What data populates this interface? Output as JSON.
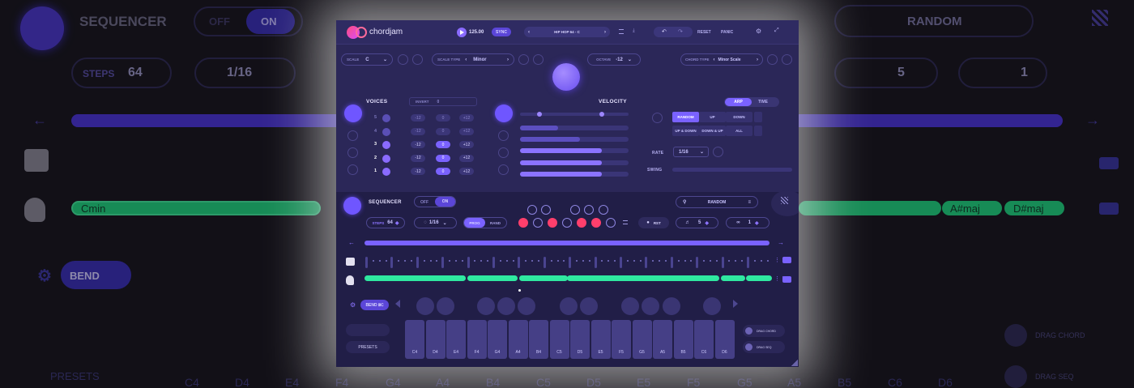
{
  "background": {
    "sequencer_label": "SEQUENCER",
    "off": "OFF",
    "on": "ON",
    "random": "RANDOM",
    "steps_label": "STEPS",
    "steps_value": "64",
    "quant": "1/16",
    "five": "5",
    "one": "1",
    "chords": [
      "Cmin",
      "A#maj",
      "D#maj"
    ],
    "bend": "BEND",
    "presets": "PRESETS",
    "drag_chord": "DRAG CHORD",
    "drag_seq": "DRAG SEQ",
    "keys": [
      "C4",
      "D4",
      "E4",
      "F4",
      "G4",
      "A4",
      "B4",
      "C5",
      "D5",
      "E5",
      "F5",
      "G5",
      "A5",
      "B5",
      "C6",
      "D6"
    ]
  },
  "app": {
    "logo": "chordjam",
    "tempo": "125.00",
    "sync": "SYNC",
    "preset_name": "HIP HOP 64 - C",
    "reset": "RESET",
    "panic": "PANIC",
    "scale_label": "SCALE",
    "scale_value": "C",
    "scale_type_label": "SCALE TYPE",
    "scale_type_value": "Minor",
    "octave_label": "OCTAVE",
    "octave_value": "-12",
    "chord_type_label": "CHORD TYPE",
    "chord_type_value": "Minor Scale",
    "voices_label": "VOICES",
    "invert_label": "INVERT",
    "invert_value": "0",
    "velocity_label": "VELOCITY",
    "voice_numbers": [
      "5",
      "4",
      "3",
      "2",
      "1"
    ],
    "voice_left": [
      "-12",
      "-12",
      "-12",
      "-12",
      "-12"
    ],
    "voice_mid": [
      "0",
      "0",
      "0",
      "0",
      "0"
    ],
    "voice_right": [
      "+12",
      "+12",
      "+12",
      "+12",
      "+12"
    ],
    "velocity_levels": [
      0.35,
      0.55,
      0.75,
      0.75,
      0.75
    ],
    "arp": "ARP",
    "time": "TIME",
    "arp_modes": [
      "RANDOM",
      "UP",
      "DOWN",
      "UP & DOWN",
      "DOWN & UP",
      "ALL"
    ],
    "rate_label": "RATE",
    "rate_value": "1/16",
    "swing_label": "SWING",
    "seq_label": "SEQUENCER",
    "seq_off": "OFF",
    "seq_on": "ON",
    "seq_random": "RANDOM",
    "steps_label": "STEPS",
    "steps_value": "64",
    "quant_value": "1/16",
    "prog": "PROG",
    "rand": "RAND",
    "rst": "RST",
    "repeat_value": "5",
    "loop_value": "1",
    "bend": "BEND",
    "presets": "PRESETS",
    "drag_chord": "DRAG CHORD",
    "drag_seq": "DRAG SEQ",
    "keys": [
      "C4",
      "D4",
      "E4",
      "F4",
      "G4",
      "A4",
      "B4",
      "C5",
      "D5",
      "E5",
      "F5",
      "G5",
      "A5",
      "B5",
      "C6",
      "D6"
    ],
    "colors": {
      "accent": "#7a62ff",
      "chord": "#2fe8a0",
      "step_on": "#ff3f6c"
    }
  }
}
